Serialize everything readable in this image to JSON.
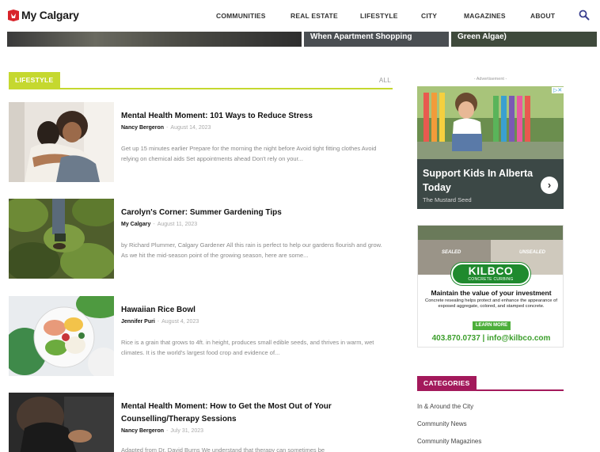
{
  "header": {
    "logo": "My Calgary",
    "nav": [
      "COMMUNITIES",
      "REAL ESTATE",
      "LIFESTYLE",
      "CITY",
      "MAGAZINES",
      "ABOUT"
    ],
    "search_icon": "search-icon"
  },
  "hero": {
    "captions": [
      "When Apartment Shopping",
      "Green Algae)"
    ]
  },
  "section": {
    "tab": "LIFESTYLE",
    "all": "ALL"
  },
  "articles": [
    {
      "title": "Mental Health Moment: 101 Ways to Reduce Stress",
      "author": "Nancy Bergeron",
      "date": "August 14, 2023",
      "excerpt": "Get up 15 minutes earlier Prepare for the morning the night before Avoid tight fitting clothes Avoid relying on chemical aids Set appointments ahead Don't rely on your..."
    },
    {
      "title": "Carolyn's Corner: Summer Gardening Tips",
      "author": "My Calgary",
      "date": "August 11, 2023",
      "excerpt": "by Richard Plummer, Calgary Gardener All this rain is perfect to help our gardens flourish and grow. As we hit the mid-season point of the growing season, here are some..."
    },
    {
      "title": "Hawaiian Rice Bowl",
      "author": "Jennifer Puri",
      "date": "August 4, 2023",
      "excerpt": "Rice is a grain that grows to 4ft. in height, produces small edible seeds, and thrives in warm, wet climates. It is the world's largest food crop and evidence of..."
    },
    {
      "title": "Mental Health Moment: How to Get the Most Out of Your Counselling/Therapy Sessions",
      "author": "Nancy Bergeron",
      "date": "July 31, 2023",
      "excerpt": "Adapted from Dr. David Burns We understand that therapy can sometimes be"
    }
  ],
  "sidebar": {
    "ad_label": "- Advertisement -",
    "ad1": {
      "title": "Support Kids In Alberta Today",
      "source": "The Mustard Seed",
      "arrow": "›",
      "badge": "▷✕"
    },
    "ad2": {
      "sealed": "SEALED",
      "unsealed": "UNSEALED",
      "brand": "KILBCO",
      "brand_sub": "CONCRETE CURBING",
      "headline": "Maintain the value of your investment",
      "body": "Concrete resealing helps protect and enhance the appearance of exposed aggregate, colored, and stamped concrete.",
      "button": "LEARN MORE",
      "contact": "403.870.0737 | info@kilbco.com"
    },
    "categories": {
      "title": "CATEGORIES",
      "items": [
        "In & Around the City",
        "Community News",
        "Community Magazines"
      ]
    }
  },
  "colors": {
    "lifestyle_accent": "#c5d82f",
    "categories_accent": "#a3195b",
    "logo_red": "#d8232a",
    "kilbco_green": "#1f8a2e"
  }
}
